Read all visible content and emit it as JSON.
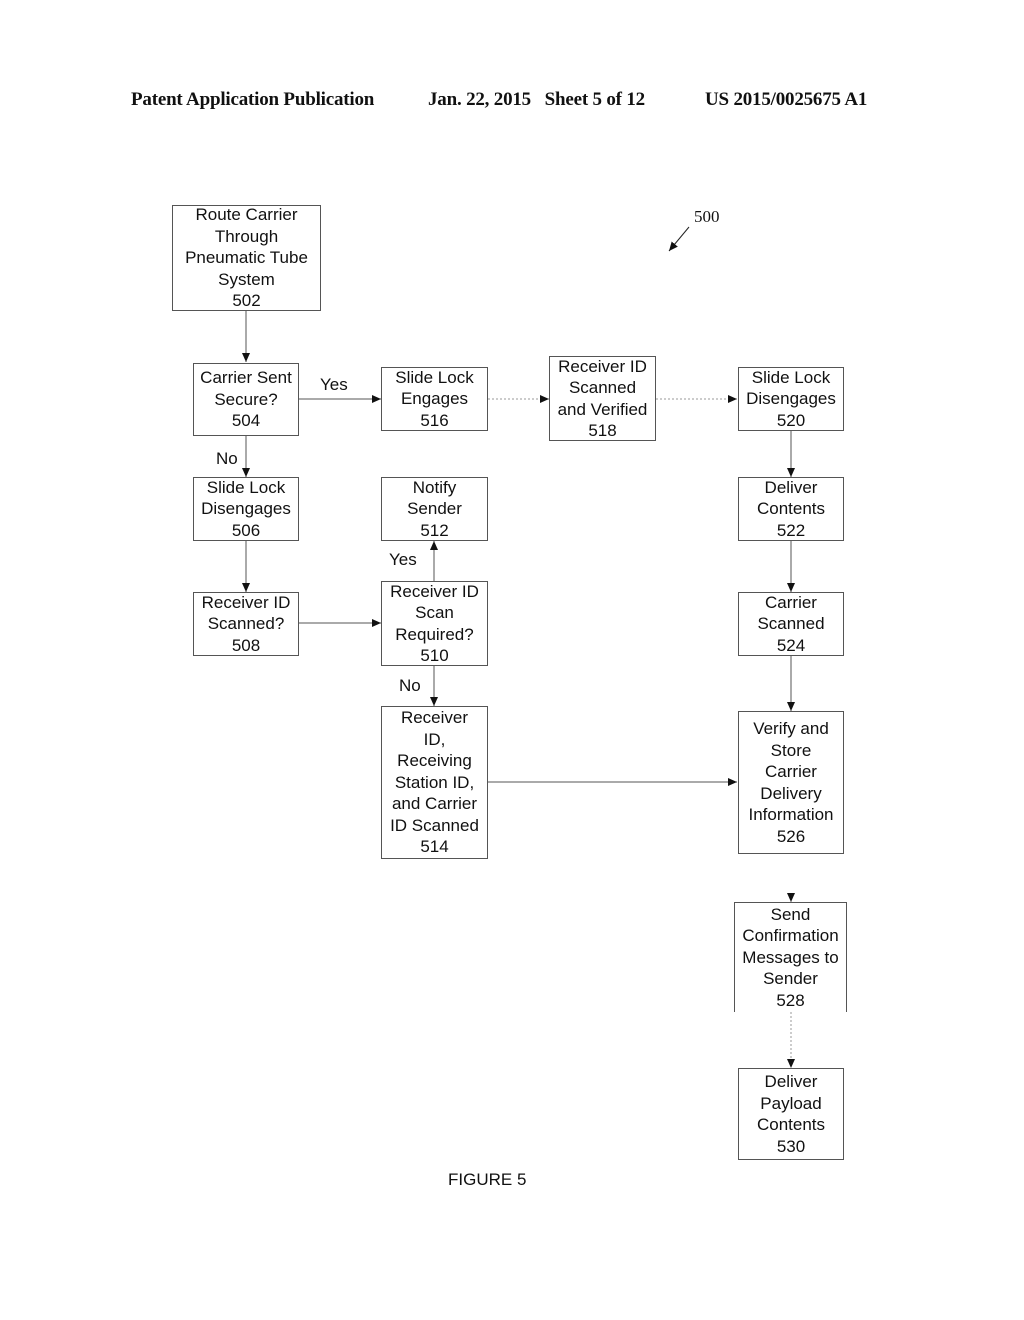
{
  "header": {
    "publication": "Patent Application Publication",
    "date_sheet": "Jan. 22, 2015   Sheet 5 of 12",
    "patent_number": "US 2015/0025675 A1"
  },
  "figure": {
    "reference_number": "500",
    "caption": "FIGURE 5"
  },
  "nodes": {
    "n502": {
      "lines": [
        "Route Carrier",
        "Through",
        "Pneumatic Tube",
        "System"
      ],
      "id": "502"
    },
    "n504": {
      "lines": [
        "Carrier Sent",
        "Secure?"
      ],
      "id": "504"
    },
    "n506": {
      "lines": [
        "Slide Lock",
        "Disengages"
      ],
      "id": "506"
    },
    "n508": {
      "lines": [
        "Receiver ID",
        "Scanned?"
      ],
      "id": "508"
    },
    "n510": {
      "lines": [
        "Receiver ID",
        "Scan",
        "Required?"
      ],
      "id": "510"
    },
    "n512": {
      "lines": [
        "Notify",
        "Sender"
      ],
      "id": "512"
    },
    "n514": {
      "lines": [
        "Receiver",
        "ID,",
        "Receiving",
        "Station ID,",
        "and Carrier",
        "ID Scanned"
      ],
      "id": "514"
    },
    "n516": {
      "lines": [
        "Slide Lock",
        "Engages"
      ],
      "id": "516"
    },
    "n518": {
      "lines": [
        "Receiver ID",
        "Scanned",
        "and Verified"
      ],
      "id": "518"
    },
    "n520": {
      "lines": [
        "Slide Lock",
        "Disengages"
      ],
      "id": "520"
    },
    "n522": {
      "lines": [
        "Deliver",
        "Contents"
      ],
      "id": "522"
    },
    "n524": {
      "lines": [
        "Carrier",
        "Scanned"
      ],
      "id": "524"
    },
    "n526": {
      "lines": [
        "Verify and",
        "Store",
        "Carrier",
        "Delivery",
        "Information"
      ],
      "id": "526"
    },
    "n528": {
      "lines": [
        "Send",
        "Confirmation",
        "Messages to",
        "Sender"
      ],
      "id": "528"
    },
    "n530": {
      "lines": [
        "Deliver",
        "Payload",
        "Contents"
      ],
      "id": "530"
    }
  },
  "edge_labels": {
    "yes_504_516": "Yes",
    "no_504_506": "No",
    "yes_510_512": "Yes",
    "no_510_514": "No"
  },
  "edges": [
    {
      "from": "502",
      "to": "504",
      "label": ""
    },
    {
      "from": "504",
      "to": "516",
      "label": "Yes"
    },
    {
      "from": "504",
      "to": "506",
      "label": "No"
    },
    {
      "from": "516",
      "to": "518",
      "label": ""
    },
    {
      "from": "518",
      "to": "520",
      "label": ""
    },
    {
      "from": "506",
      "to": "508",
      "label": ""
    },
    {
      "from": "508",
      "to": "510",
      "label": ""
    },
    {
      "from": "510",
      "to": "512",
      "label": "Yes"
    },
    {
      "from": "510",
      "to": "514",
      "label": "No"
    },
    {
      "from": "514",
      "to": "526",
      "label": ""
    },
    {
      "from": "520",
      "to": "522",
      "label": ""
    },
    {
      "from": "522",
      "to": "524",
      "label": ""
    },
    {
      "from": "524",
      "to": "526",
      "label": ""
    },
    {
      "from": "526",
      "to": "528",
      "label": ""
    },
    {
      "from": "528",
      "to": "530",
      "label": ""
    }
  ]
}
